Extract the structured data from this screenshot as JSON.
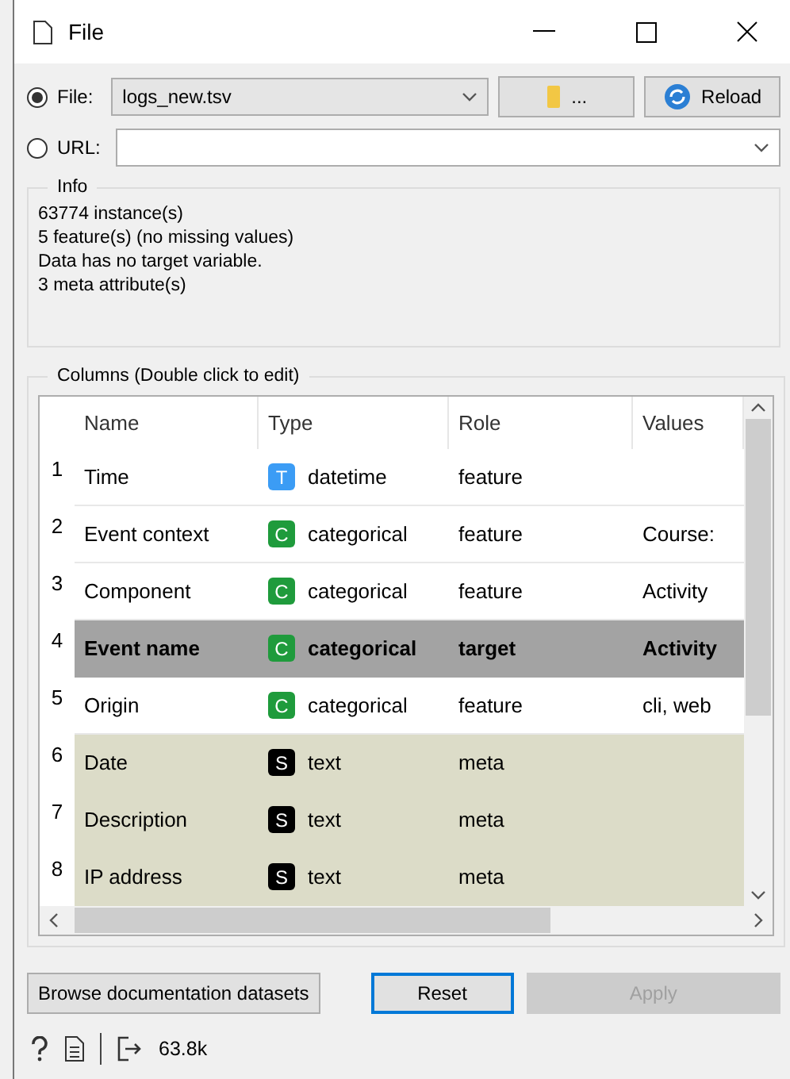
{
  "window": {
    "title": "File"
  },
  "source": {
    "options": [
      {
        "label": "File:",
        "selected": true,
        "value": "logs_new.tsv"
      },
      {
        "label": "URL:",
        "selected": false
      }
    ],
    "browse_label": "...",
    "reload_label": "Reload"
  },
  "info": {
    "title": "Info",
    "lines": [
      "63774 instance(s)",
      "5 feature(s) (no missing values)",
      "Data has no target variable.",
      "3 meta attribute(s)"
    ]
  },
  "columns": {
    "title": "Columns (Double click to edit)",
    "headers": [
      "Name",
      "Type",
      "Role",
      "Values"
    ],
    "rows": [
      {
        "index": "1",
        "name": "Time",
        "type_letter": "T",
        "color": "#3b9cf5",
        "type": "datetime",
        "role": "feature",
        "kind": "feature",
        "selected": false
      },
      {
        "index": "2",
        "name": "Event context",
        "type_letter": "C",
        "color": "#1f9b3c",
        "type": "categorical",
        "role": "feature",
        "values": "Course:",
        "kind": "feature",
        "selected": false
      },
      {
        "index": "3",
        "name": "Component",
        "type_letter": "C",
        "color": "#1f9b3c",
        "type": "categorical",
        "role": "feature",
        "values": "Activity",
        "kind": "feature",
        "selected": false
      },
      {
        "index": "4",
        "name": "Event name",
        "type_letter": "C",
        "color": "#1f9b3c",
        "type": "categorical",
        "role": "target",
        "values": "Activity",
        "kind": "target",
        "selected": true
      },
      {
        "index": "5",
        "name": "Origin",
        "type_letter": "C",
        "color": "#1f9b3c",
        "type": "categorical",
        "role": "feature",
        "values": "cli, web",
        "kind": "feature",
        "selected": false
      },
      {
        "index": "6",
        "name": "Date",
        "type_letter": "S",
        "color": "#000000",
        "type": "text",
        "role": "meta",
        "kind": "meta",
        "selected": false
      },
      {
        "index": "7",
        "name": "Description",
        "type_letter": "S",
        "color": "#000000",
        "type": "text",
        "role": "meta",
        "kind": "meta",
        "selected": false
      },
      {
        "index": "8",
        "name": "IP address",
        "type_letter": "S",
        "color": "#000000",
        "type": "text",
        "role": "meta",
        "kind": "meta",
        "selected": false
      }
    ]
  },
  "buttons": [
    {
      "label": "Browse documentation datasets",
      "kind": "plain",
      "disabled": false
    },
    {
      "label": "Reset",
      "kind": "focused",
      "disabled": false
    },
    {
      "label": "Apply",
      "kind": "plain",
      "disabled": true
    }
  ],
  "status_bar": {
    "output_size": "63.8k"
  }
}
